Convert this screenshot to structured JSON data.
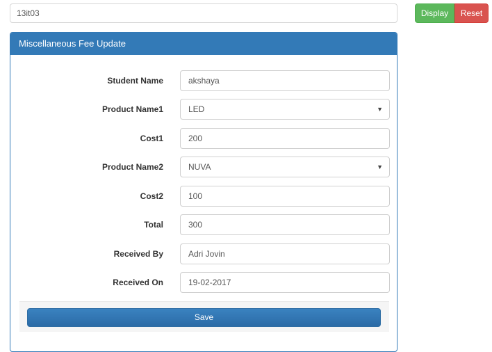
{
  "search": {
    "value": "13it03"
  },
  "actions": {
    "display_label": "Display",
    "reset_label": "Reset"
  },
  "colors": {
    "primary": "#337ab7",
    "success": "#5cb85c",
    "danger": "#d9534f"
  },
  "panel": {
    "title": "Miscellaneous Fee Update",
    "fields": [
      {
        "label": "Student Name",
        "value": "akshaya",
        "type": "text"
      },
      {
        "label": "Product Name1",
        "value": "LED",
        "type": "select"
      },
      {
        "label": "Cost1",
        "value": "200",
        "type": "text"
      },
      {
        "label": "Product Name2",
        "value": "NUVA",
        "type": "select"
      },
      {
        "label": "Cost2",
        "value": "100",
        "type": "text"
      },
      {
        "label": "Total",
        "value": "300",
        "type": "text"
      },
      {
        "label": "Received By",
        "value": "Adri Jovin",
        "type": "text"
      },
      {
        "label": "Received On",
        "value": "19-02-2017",
        "type": "text"
      }
    ],
    "save_label": "Save",
    "select_caret_icon": "caret-down-icon"
  }
}
